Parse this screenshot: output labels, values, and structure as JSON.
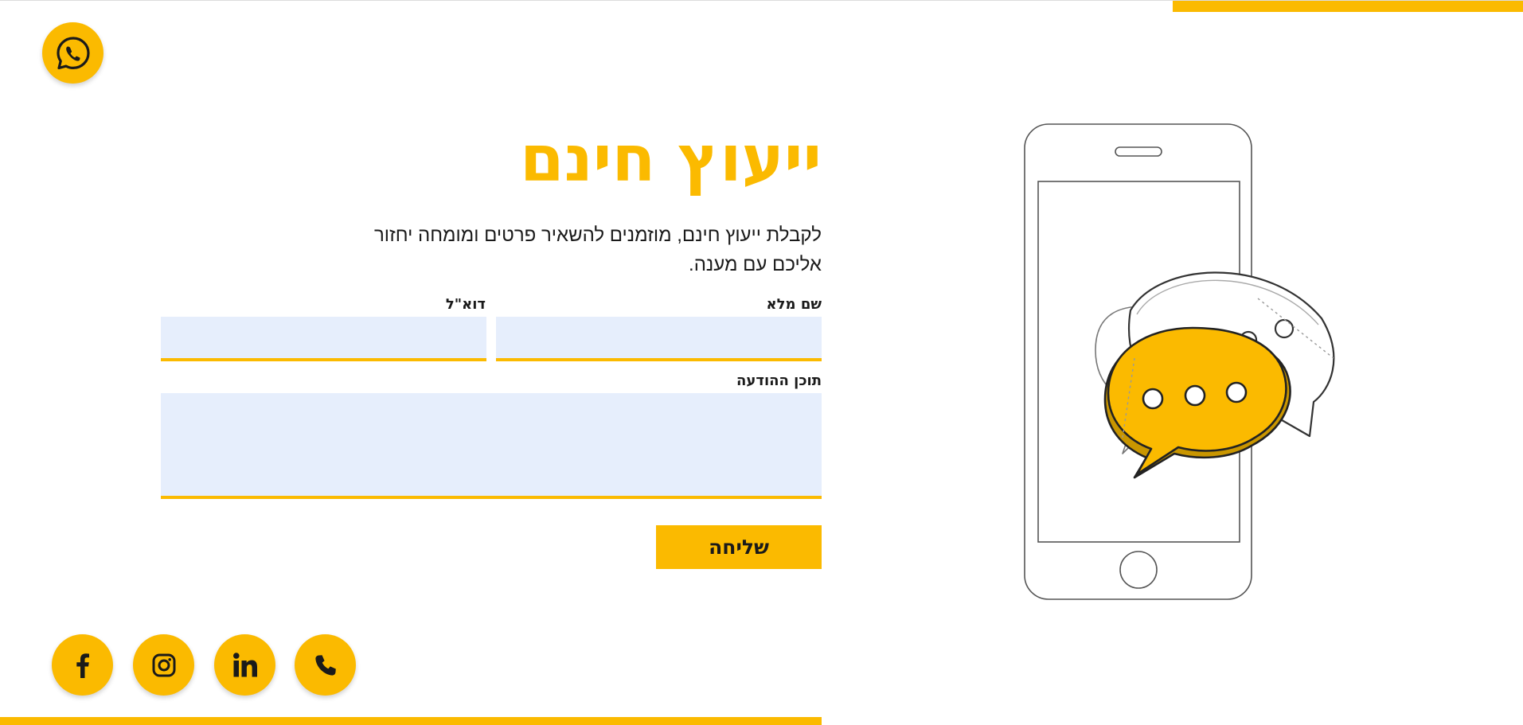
{
  "hero": {
    "title": "ייעוץ חינם",
    "subtitle": "לקבלת ייעוץ חינם, מוזמנים להשאיר פרטים ומומחה יחזור אליכם עם מענה."
  },
  "form": {
    "full_name_label": "שם מלא",
    "full_name_value": "",
    "email_label": "דוא\"ל",
    "email_value": "",
    "message_label": "תוכן ההודעה",
    "message_value": "",
    "submit_label": "שליחה"
  },
  "floating": {
    "whatsapp_icon": "whatsapp-icon"
  },
  "social": [
    {
      "icon": "facebook-icon"
    },
    {
      "icon": "instagram-icon"
    },
    {
      "icon": "linkedin-icon"
    },
    {
      "icon": "phone-icon"
    }
  ],
  "colors": {
    "accent": "#fbba00",
    "field_background": "#e6eefc",
    "text": "#1a1a1a",
    "background": "#ffffff"
  }
}
